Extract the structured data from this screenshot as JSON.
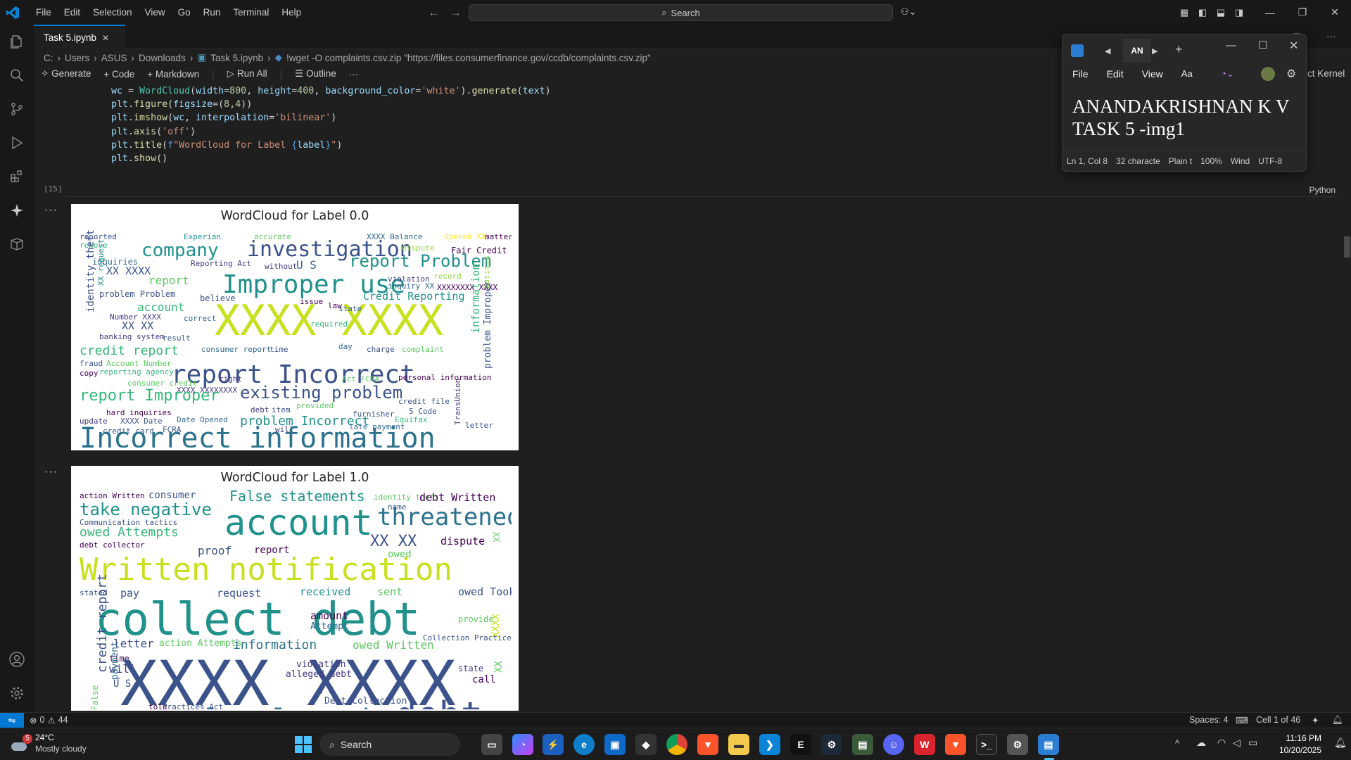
{
  "menu": [
    "File",
    "Edit",
    "Selection",
    "View",
    "Go",
    "Run",
    "Terminal",
    "Help"
  ],
  "search": {
    "label": "Search"
  },
  "tab": {
    "name": "Task 5.ipynb",
    "close": "✕"
  },
  "breadcrumb": [
    "C:",
    "Users",
    "ASUS",
    "Downloads",
    "Task 5.ipynb",
    "!wget -O complaints.csv.zip \"https://files.consumerfinance.gov/ccdb/complaints.csv.zip\""
  ],
  "toolbar": {
    "generate": "Generate",
    "code": "Code",
    "markdown": "Markdown",
    "run_all": "Run All",
    "outline": "Outline",
    "more": "···",
    "kernel": "ct Kernel"
  },
  "code_lines": [
    "wc = WordCloud(width=800, height=400, background_color='white').generate(text)",
    "plt.figure(figsize=(8,4))",
    "plt.imshow(wc, interpolation='bilinear')",
    "plt.axis('off')",
    "plt.title(f\"WordCloud for Label {label}\")",
    "plt.show()"
  ],
  "cell": {
    "exec_count": "[15]",
    "language": "Python",
    "output_dots": "···"
  },
  "wordclouds": [
    {
      "title": "WordCloud for Label 0.0"
    },
    {
      "title": "WordCloud for Label 1.0"
    }
  ],
  "notepad": {
    "tab_label": "AN",
    "menu": [
      "File",
      "Edit",
      "View"
    ],
    "text_line1": "ANANDAKRISHNAN K V",
    "text_line2": "TASK 5 -img1",
    "status": [
      "Ln 1, Col 8",
      "32 characte",
      "Plain t",
      "100%",
      "Wind",
      "UTF-8"
    ]
  },
  "statusbar": {
    "problems_errors": "0",
    "problems_warnings": "44",
    "spaces": "Spaces: 4",
    "cell": "Cell 1 of 46"
  },
  "taskbar": {
    "weather_temp": "24°C",
    "weather_desc": "Mostly cloudy",
    "weather_badge": "5",
    "search": "Search",
    "time": "11:16 PM",
    "date": "10/20/2025"
  },
  "colors": {
    "accent": "#0078d4",
    "editor_bg": "#1f1f1f",
    "chrome_bg": "#181818"
  }
}
